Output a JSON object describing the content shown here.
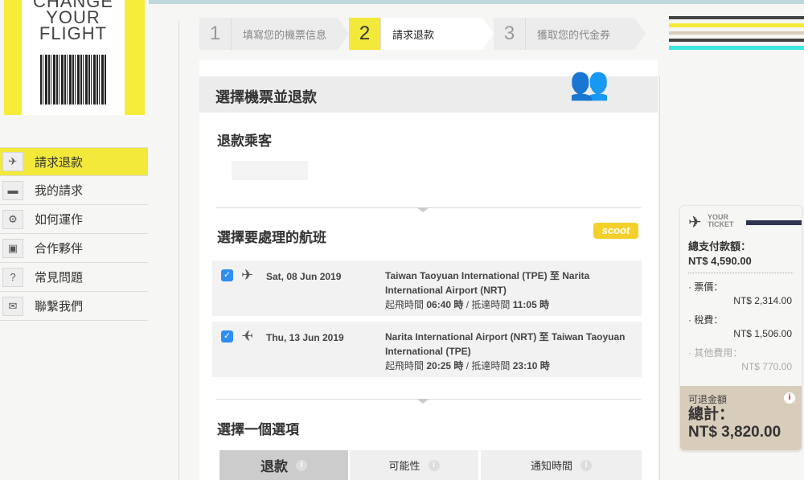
{
  "logo": {
    "lines": [
      "CHANGE",
      "YOUR",
      "FLIGHT"
    ]
  },
  "nav": [
    {
      "label": "請求退款",
      "icon": "✈"
    },
    {
      "label": "我的請求",
      "icon": "▬"
    },
    {
      "label": "如何運作",
      "icon": "⚙"
    },
    {
      "label": "合作夥伴",
      "icon": "▣"
    },
    {
      "label": "常見問題",
      "icon": "?"
    },
    {
      "label": "聯繫我們",
      "icon": "✉"
    }
  ],
  "steps": [
    {
      "num": "1",
      "label": "填寫您的機票信息"
    },
    {
      "num": "2",
      "label": "請求退款"
    },
    {
      "num": "3",
      "label": "獲取您的代金券"
    }
  ],
  "main": {
    "title": "選擇機票並退款",
    "passenger_heading": "退款乘客",
    "flights_heading": "選擇要處理的航班",
    "airline_logo": "scoot",
    "options_heading": "選擇一個選項",
    "flights": [
      {
        "date": "Sat, 08 Jun 2019",
        "route": "Taiwan Taoyuan International (TPE) 至 Narita International Airport (NRT)",
        "dep_label": "起飛時間",
        "dep": "06:40 時",
        "arr_label": "/ 抵達時間",
        "arr": "11:05 時",
        "checked": true
      },
      {
        "date": "Thu, 13 Jun 2019",
        "route": "Narita International Airport (NRT) 至 Taiwan Taoyuan International (TPE)",
        "dep_label": "起飛時間",
        "dep": "20:25 時",
        "arr_label": "/ 抵達時間",
        "arr": "23:10 時",
        "checked": true
      }
    ],
    "option_tabs": [
      "退款",
      "可能性",
      "通知時間"
    ]
  },
  "ticket": {
    "brand": [
      "YOUR",
      "TICKET"
    ],
    "total_paid_label": "總支付款額：",
    "total_paid": "NT$ 4,590.00",
    "fare_label": "· 票價：",
    "fare": "NT$ 2,314.00",
    "tax_label": "· 稅費：",
    "tax": "NT$ 1,506.00",
    "other_label": "· 其他費用：",
    "other": "NT$ 770.00",
    "refund_label": "可退金額",
    "sum_label": "總計：",
    "sum": "NT$ 3,820.00"
  }
}
